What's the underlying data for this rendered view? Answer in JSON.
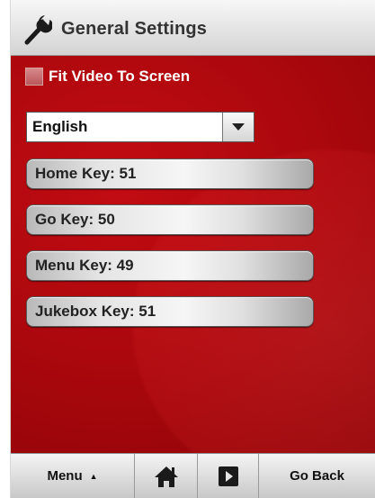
{
  "header": {
    "title": "General Settings",
    "icon": "wrench-icon"
  },
  "settings": {
    "fit_video_label": "Fit Video To Screen",
    "fit_video_checked": false,
    "language": "English"
  },
  "keys": {
    "home": "Home Key: 51",
    "go": "Go Key: 50",
    "menu": "Menu Key: 49",
    "jukebox": "Jukebox Key: 51"
  },
  "footer": {
    "menu_label": "Menu",
    "menu_caret": "▲",
    "home_icon": "home-icon",
    "play_icon": "play-icon",
    "back_label": "Go Back"
  },
  "colors": {
    "background_red": "#b0090f",
    "header_gray": "#e4e4e4"
  }
}
